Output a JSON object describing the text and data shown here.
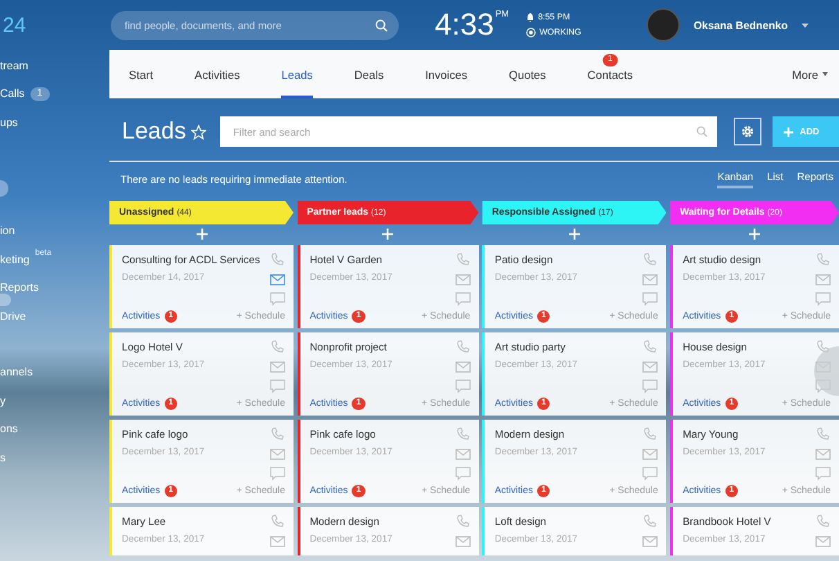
{
  "sidebar": {
    "logo": "24",
    "sections": [
      {
        "items": [
          {
            "label": "tream"
          },
          {
            "label": "Calls",
            "badge": "1"
          },
          {
            "label": "ups"
          }
        ]
      },
      {
        "items": [
          {
            "label": "ion"
          },
          {
            "label": "keting",
            "tag": "beta"
          },
          {
            "label": "Reports"
          },
          {
            "label": "Drive"
          }
        ]
      },
      {
        "items": [
          {
            "label": "annels"
          },
          {
            "label": "y"
          },
          {
            "label": "ons"
          },
          {
            "label": "s"
          }
        ]
      }
    ]
  },
  "top_bar": {
    "search": {
      "placeholder": "find people, documents, and more"
    },
    "clock": {
      "time": "4:33",
      "ampm": "PM"
    },
    "alarm": "8:55 PM",
    "status": "WORKING",
    "user": {
      "name": "Oksana Bednenko"
    }
  },
  "nav": {
    "tabs": [
      {
        "label": "Start",
        "selected": false
      },
      {
        "label": "Activities",
        "selected": false
      },
      {
        "label": "Leads",
        "selected": true
      },
      {
        "label": "Deals",
        "selected": false
      },
      {
        "label": "Invoices",
        "selected": false
      },
      {
        "label": "Quotes",
        "selected": false
      },
      {
        "label": "Contacts",
        "selected": false,
        "badge": "1"
      }
    ],
    "more": "More"
  },
  "header": {
    "title": "Leads",
    "filter": {
      "placeholder": "Filter and search"
    },
    "add_button": "ADD"
  },
  "notice": "There are no leads requiring immediate attention.",
  "view_switch": [
    {
      "label": "Kanban",
      "selected": true
    },
    {
      "label": "List",
      "selected": false
    },
    {
      "label": "Reports",
      "selected": false
    }
  ],
  "columns": [
    {
      "title": "Unassigned",
      "count": "(44)",
      "color": "#f5e833",
      "cards": [
        {
          "title": "Consulting for ACDL Services",
          "date": "December 14, 2017",
          "mail_highlighted": true,
          "activities": "Activities",
          "activities_count": "1",
          "schedule": "+ Schedule"
        },
        {
          "title": "Logo Hotel V",
          "date": "December 13, 2017",
          "mail_highlighted": false,
          "activities": "Activities",
          "activities_count": "1",
          "schedule": "+ Schedule"
        },
        {
          "title": "Pink cafe logo",
          "date": "December 13, 2017",
          "mail_highlighted": false,
          "activities": "Activities",
          "activities_count": "1",
          "schedule": "+ Schedule"
        },
        {
          "title": "Mary Lee",
          "date": "December 13, 2017",
          "mail_highlighted": false
        }
      ]
    },
    {
      "title": "Partner leads",
      "count": "(12)",
      "color": "#e8232b",
      "cards": [
        {
          "title": "Hotel V Garden",
          "date": "December 13, 2017",
          "mail_highlighted": false,
          "activities": "Activities",
          "activities_count": "1",
          "schedule": "+ Schedule"
        },
        {
          "title": "Nonprofit project",
          "date": "December 13, 2017",
          "mail_highlighted": false,
          "activities": "Activities",
          "activities_count": "1",
          "schedule": "+ Schedule"
        },
        {
          "title": "Pink cafe logo",
          "date": "December 13, 2017",
          "mail_highlighted": false,
          "activities": "Activities",
          "activities_count": "1",
          "schedule": "+ Schedule"
        },
        {
          "title": "Modern design",
          "date": "December 13, 2017",
          "mail_highlighted": false
        }
      ]
    },
    {
      "title": "Responsible Assigned",
      "count": "(17)",
      "color": "#2ef5f5",
      "cards": [
        {
          "title": "Patio design",
          "date": "December 13, 2017",
          "mail_highlighted": false,
          "activities": "Activities",
          "activities_count": "1",
          "schedule": "+ Schedule"
        },
        {
          "title": "Art studio party",
          "date": "December 13, 2017",
          "mail_highlighted": false,
          "activities": "Activities",
          "activities_count": "1",
          "schedule": "+ Schedule"
        },
        {
          "title": "Modern design",
          "date": "December 13, 2017",
          "mail_highlighted": false,
          "activities": "Activities",
          "activities_count": "1",
          "schedule": "+ Schedule"
        },
        {
          "title": "Loft design",
          "date": "December 13, 2017",
          "mail_highlighted": false
        }
      ]
    },
    {
      "title": "Waiting for Details",
      "count": "(20)",
      "color": "#f22ef2",
      "cards": [
        {
          "title": "Art studio design",
          "date": "December 13, 2017",
          "mail_highlighted": false,
          "activities": "Activities",
          "activities_count": "1",
          "schedule": "+ Schedule"
        },
        {
          "title": "House design",
          "date": "December 13, 2017",
          "mail_highlighted": false,
          "activities": "Activities",
          "activities_count": "1",
          "schedule": "+ Schedule"
        },
        {
          "title": "Mary Young",
          "date": "December 13, 2017",
          "mail_highlighted": false,
          "activities": "Activities",
          "activities_count": "1",
          "schedule": "+ Schedule"
        },
        {
          "title": "Brandbook Hotel V",
          "date": "December 13, 2017",
          "mail_highlighted": false
        }
      ]
    }
  ]
}
